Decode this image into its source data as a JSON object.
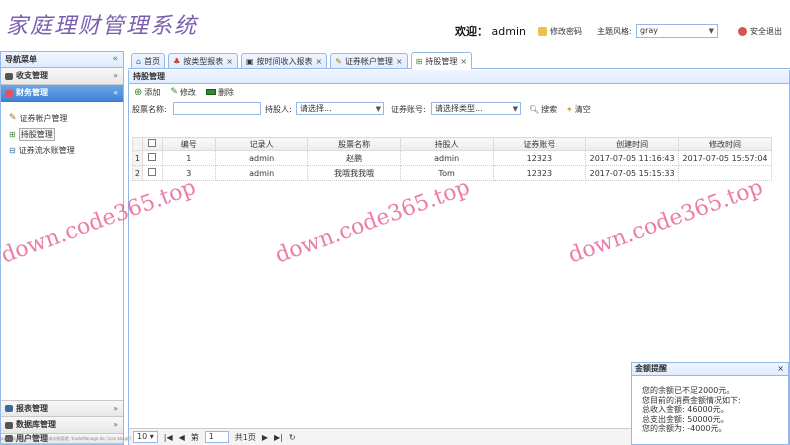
{
  "header": {
    "logo": "家庭理财管理系统",
    "welcome_label": "欢迎：",
    "username": "admin",
    "change_password": "修改密码",
    "theme_label": "主题风格:",
    "theme_value": "gray",
    "logout": "安全退出"
  },
  "nav": {
    "title": "导航菜单",
    "sections": [
      {
        "label": "收支管理"
      },
      {
        "label": "财务管理"
      },
      {
        "label": "报表管理"
      },
      {
        "label": "数据库管理"
      },
      {
        "label": "用户管理"
      }
    ],
    "finance_items": [
      {
        "label": "证券帐户管理"
      },
      {
        "label": "持股管理"
      },
      {
        "label": "证券流水账管理"
      }
    ]
  },
  "tabs": [
    {
      "label": "首页"
    },
    {
      "label": "按类型报表"
    },
    {
      "label": "按时间收入报表"
    },
    {
      "label": "证券帐户管理"
    },
    {
      "label": "持股管理"
    }
  ],
  "panel": {
    "title": "持股管理",
    "toolbar": {
      "add": "添加",
      "edit": "修改",
      "delete": "删除"
    },
    "search": {
      "stock_name_label": "股票名称:",
      "holder_label": "持股人:",
      "holder_value": "请选择...",
      "account_label": "证券账号:",
      "account_value": "请选择类型...",
      "search_btn": "搜索",
      "clear_btn": "清空"
    },
    "columns": [
      "编号",
      "记录人",
      "股票名称",
      "持股人",
      "证券账号",
      "创建时间",
      "修改时间"
    ],
    "rows": [
      {
        "rownum": "1",
        "id": "1",
        "recorder": "admin",
        "stock": "赵鹏",
        "holder": "admin",
        "account": "12323",
        "created": "2017-07-05 11:16:43",
        "modified": "2017-07-05 15:57:04"
      },
      {
        "rownum": "2",
        "id": "3",
        "recorder": "admin",
        "stock": "我哦我我哦",
        "holder": "Tom",
        "account": "12323",
        "created": "2017-07-05 15:15:33",
        "modified": ""
      }
    ],
    "pager": {
      "page_size": "10",
      "page_prefix": "第",
      "page_value": "1",
      "page_total": "共1页"
    }
  },
  "watermark": "down.code365.top",
  "notice": {
    "title": "金额提醒",
    "lines": [
      "您的余额已不足2000元。",
      "您目前的消费金额情况如下:",
      "总收入金额:   46000元。",
      "总支出金额:   50000元。",
      "您的余额为:   -4000元。"
    ]
  },
  "status_url": "javascript:openTab('证券流水账管理','tradeManage.do','icon-kbsgl')",
  "colors": {
    "border": "#95b8e7",
    "selected": "#4183d7",
    "logo": "#7a5fb0",
    "watermark": "#e6508c"
  }
}
